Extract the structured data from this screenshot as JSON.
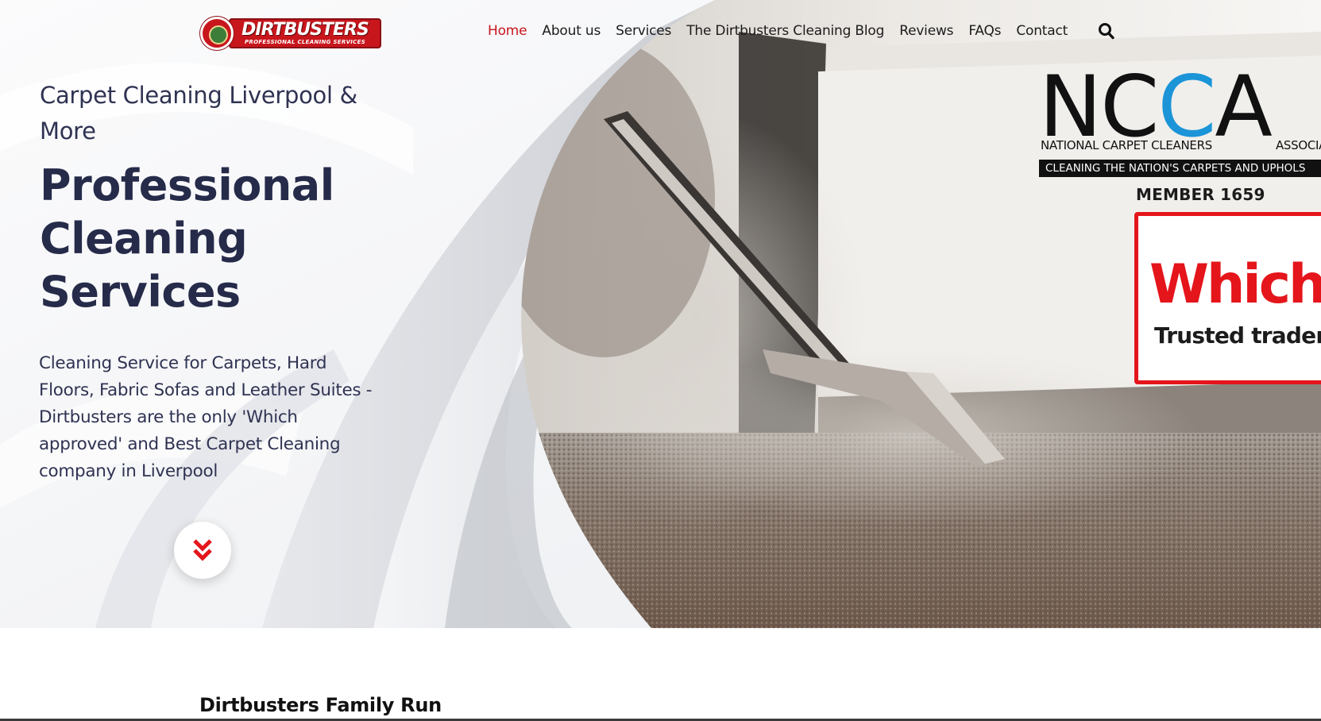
{
  "brand": {
    "name": "DIRTBUSTERS",
    "tagline": "PROFESSIONAL CLEANING SERVICES"
  },
  "nav": {
    "items": [
      {
        "label": "Home",
        "active": true
      },
      {
        "label": "About us",
        "active": false
      },
      {
        "label": "Services",
        "active": false
      },
      {
        "label": "The Dirtbusters Cleaning Blog",
        "active": false
      },
      {
        "label": "Reviews",
        "active": false
      },
      {
        "label": "FAQs",
        "active": false
      },
      {
        "label": "Contact",
        "active": false
      }
    ],
    "search_icon": "search-icon"
  },
  "hero": {
    "eyebrow": "Carpet Cleaning Liverpool & More",
    "headline": "Professional Cleaning Services",
    "intro": "Cleaning Service for Carpets, Hard Floors, Fabric Sofas and Leather Suites - Dirtbusters are the only 'Which approved' and Best Carpet Cleaning company in Liverpool",
    "scroll_icon": "double-chevron-down-icon"
  },
  "badges": {
    "ncca": {
      "letters_a": "N",
      "letters_b": "C",
      "letters_c": "C",
      "letters_d": "A",
      "name_left": "NATIONAL CARPET CLEANERS",
      "name_right": "ASSOCIA",
      "strap": "CLEANING THE NATION'S CARPETS AND UPHOLS",
      "member": "MEMBER 1659"
    },
    "which": {
      "word": "Which?",
      "trader": "Trusted trader"
    }
  },
  "section": {
    "title": "Dirtbusters Family Run"
  },
  "colors": {
    "accent": "#c8161d",
    "text_dark": "#262b4a",
    "which_red": "#e4151b",
    "ncca_blue": "#1b95d8"
  }
}
